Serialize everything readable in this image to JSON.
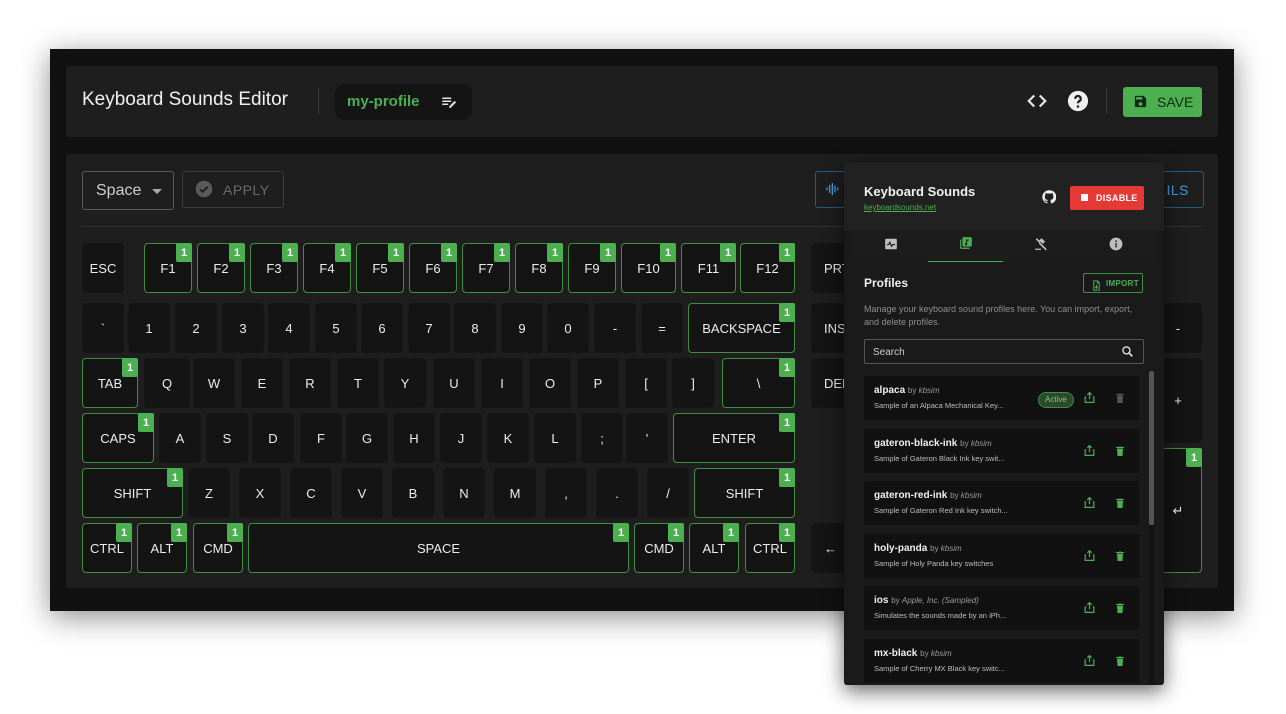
{
  "header": {
    "title": "Keyboard Sounds Editor",
    "profile_name": "my-profile",
    "save_label": "SAVE"
  },
  "controls": {
    "key_select": "Space",
    "apply_label": "APPLY",
    "sound_details_label": "ILS"
  },
  "keyboard": {
    "badge": "1",
    "rows": [
      [
        [
          "ESC",
          false
        ],
        [
          "F1",
          true
        ],
        [
          "F2",
          true
        ],
        [
          "F3",
          true
        ],
        [
          "F4",
          true
        ],
        [
          "F5",
          true
        ],
        [
          "F6",
          true
        ],
        [
          "F7",
          true
        ],
        [
          "F8",
          true
        ],
        [
          "F9",
          true
        ],
        [
          "F10",
          true
        ],
        [
          "F11",
          true
        ],
        [
          "F12",
          true
        ]
      ],
      [
        [
          "`",
          false
        ],
        [
          "1",
          false
        ],
        [
          "2",
          false
        ],
        [
          "3",
          false
        ],
        [
          "4",
          false
        ],
        [
          "5",
          false
        ],
        [
          "6",
          false
        ],
        [
          "7",
          false
        ],
        [
          "8",
          false
        ],
        [
          "9",
          false
        ],
        [
          "0",
          false
        ],
        [
          "-",
          false
        ],
        [
          "=",
          false
        ],
        [
          "BACKSPACE",
          true
        ]
      ],
      [
        [
          "TAB",
          true
        ],
        [
          "Q",
          false
        ],
        [
          "W",
          false
        ],
        [
          "E",
          false
        ],
        [
          "R",
          false
        ],
        [
          "T",
          false
        ],
        [
          "Y",
          false
        ],
        [
          "U",
          false
        ],
        [
          "I",
          false
        ],
        [
          "O",
          false
        ],
        [
          "P",
          false
        ],
        [
          "[",
          false
        ],
        [
          "]",
          false
        ],
        [
          "\\",
          true
        ]
      ],
      [
        [
          "CAPS",
          true
        ],
        [
          "A",
          false
        ],
        [
          "S",
          false
        ],
        [
          "D",
          false
        ],
        [
          "F",
          false
        ],
        [
          "G",
          false
        ],
        [
          "H",
          false
        ],
        [
          "J",
          false
        ],
        [
          "K",
          false
        ],
        [
          "L",
          false
        ],
        [
          ";",
          false
        ],
        [
          "'",
          false
        ],
        [
          "ENTER",
          true
        ]
      ],
      [
        [
          "SHIFT",
          true
        ],
        [
          "Z",
          false
        ],
        [
          "X",
          false
        ],
        [
          "C",
          false
        ],
        [
          "V",
          false
        ],
        [
          "B",
          false
        ],
        [
          "N",
          false
        ],
        [
          "M",
          false
        ],
        [
          ",",
          false
        ],
        [
          ".",
          false
        ],
        [
          "/",
          false
        ],
        [
          "SHIFT",
          true
        ]
      ],
      [
        [
          "CTRL",
          true
        ],
        [
          "ALT",
          true
        ],
        [
          "CMD",
          true
        ],
        [
          "SPACE",
          true
        ],
        [
          "CMD",
          true
        ],
        [
          "ALT",
          true
        ],
        [
          "CTRL",
          true
        ]
      ]
    ],
    "nav_keys": [
      "PRT",
      "INS",
      "DEL",
      "←"
    ],
    "numpad_keys": [
      "-",
      "+",
      "↵"
    ]
  },
  "panel": {
    "title": "Keyboard Sounds",
    "link": "keyboardsounds.net",
    "disable_label": "DISABLE",
    "section_title": "Profiles",
    "import_label": "IMPORT",
    "description": "Manage your keyboard sound profiles here. You can import, export, and delete profiles.",
    "search_placeholder": "Search",
    "by_word": "by",
    "active_label": "Active",
    "profiles": [
      {
        "name": "alpaca",
        "author": "kbsim",
        "desc": "Sample of an Alpaca Mechanical Key...",
        "active": true
      },
      {
        "name": "gateron-black-ink",
        "author": "kbsim",
        "desc": "Sample of Gateron Black Ink key swit...",
        "active": false
      },
      {
        "name": "gateron-red-ink",
        "author": "kbsim",
        "desc": "Sample of Gateron Red Ink key switch...",
        "active": false
      },
      {
        "name": "holy-panda",
        "author": "kbsim",
        "desc": "Sample of Holy Panda key switches",
        "active": false
      },
      {
        "name": "ios",
        "author": "Apple, Inc. (Sampled)",
        "desc": "Simulates the sounds made by an iPh...",
        "active": false
      },
      {
        "name": "mx-black",
        "author": "kbsim",
        "desc": "Sample of Cherry MX Black key switc...",
        "active": false
      }
    ]
  },
  "colors": {
    "accent": "#4caf50",
    "danger": "#e53935",
    "info": "#3aa0e0"
  }
}
